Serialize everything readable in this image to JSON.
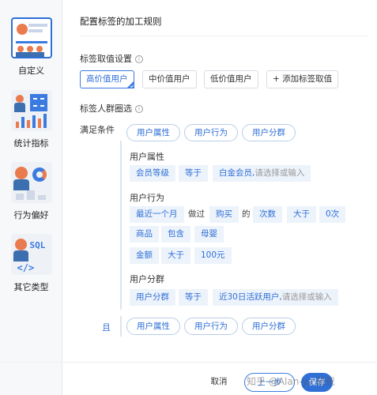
{
  "sidebar": {
    "items": [
      {
        "label": "自定义",
        "icon": "custom-audience-icon"
      },
      {
        "label": "统计指标",
        "icon": "statistics-chart-icon"
      },
      {
        "label": "行为偏好",
        "icon": "behavior-preference-icon"
      },
      {
        "label": "其它类型",
        "icon": "sql-code-icon"
      }
    ]
  },
  "header": {
    "title": "配置标签的加工规则"
  },
  "value_settings": {
    "title": "标签取值设置",
    "options": [
      "高价值用户",
      "中价值用户",
      "低价值用户"
    ],
    "add_button": "+ 添加标签取值"
  },
  "audience": {
    "title": "标签人群圈选",
    "condition_label": "满足条件",
    "type_buttons": [
      "用户属性",
      "用户行为",
      "用户分群"
    ],
    "and_label": "且",
    "and_buttons": [
      "用户属性",
      "用户行为",
      "用户分群"
    ]
  },
  "attr_group": {
    "title": "用户属性",
    "field": "会员等级",
    "op": "等于",
    "value": "白金会员,",
    "placeholder": "请选择或输入"
  },
  "behavior_group": {
    "title": "用户行为",
    "time": "最近一个月",
    "did": "做过",
    "action": "购买",
    "of": "的",
    "metric": "次数",
    "op": "大于",
    "value": "0次",
    "filter1_field": "商品",
    "filter1_op": "包含",
    "filter1_value": "母婴",
    "filter2_field": "金额",
    "filter2_op": "大于",
    "filter2_value": "100元"
  },
  "segment_group": {
    "title": "用户分群",
    "field": "用户分群",
    "op": "等于",
    "value": "近30日活跃用户,",
    "placeholder": "请选择或输入"
  },
  "footer": {
    "cancel": "取消",
    "prev": "上一步",
    "save": "保存",
    "watermark": "知乎 @Alan-ys 易观"
  },
  "colors": {
    "accent": "#2f6fd6",
    "chip_bg": "#edf3fb"
  }
}
